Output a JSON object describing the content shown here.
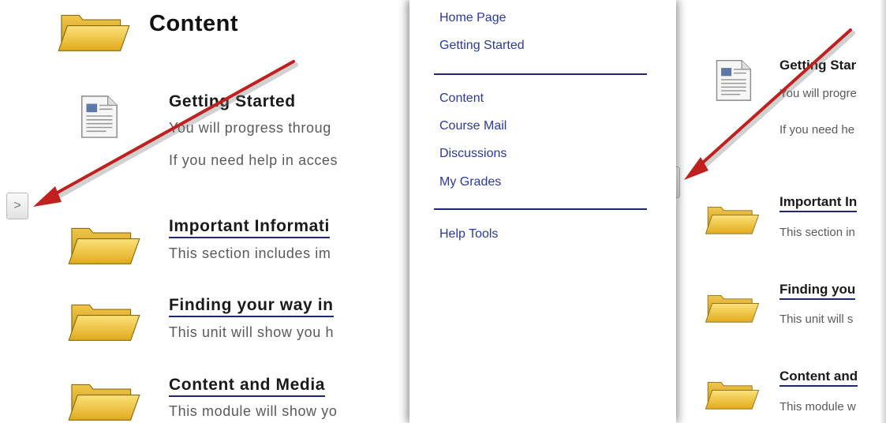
{
  "left": {
    "title": "Content",
    "items": [
      {
        "title": "Getting Started",
        "desc1": "You will progress throug",
        "desc2": "If you need help in acces"
      },
      {
        "title": "Important Informati",
        "desc": "This section includes im"
      },
      {
        "title": "Finding your way in",
        "desc": "This unit will show you h"
      },
      {
        "title": "Content and Media",
        "desc": "This module will show yo"
      }
    ],
    "toggle_label": ">"
  },
  "nav": {
    "group1": [
      "Home Page",
      "Getting Started"
    ],
    "group2": [
      "Content",
      "Course Mail",
      "Discussions",
      "My Grades"
    ],
    "group3": [
      "Help Tools"
    ]
  },
  "right": {
    "items": [
      {
        "title": "Getting Star",
        "desc1": "You will progre",
        "desc2": "If you need he"
      },
      {
        "title": "Important In",
        "desc": "This section in"
      },
      {
        "title": "Finding you",
        "desc": "This unit will s"
      },
      {
        "title": "Content and",
        "desc": "This module w"
      }
    ],
    "toggle_label": "<"
  },
  "colors": {
    "arrow": "#c0201e",
    "link_blue": "#2a3a9c",
    "underline": "#1f2a6e",
    "folder": "#f3c84a"
  }
}
